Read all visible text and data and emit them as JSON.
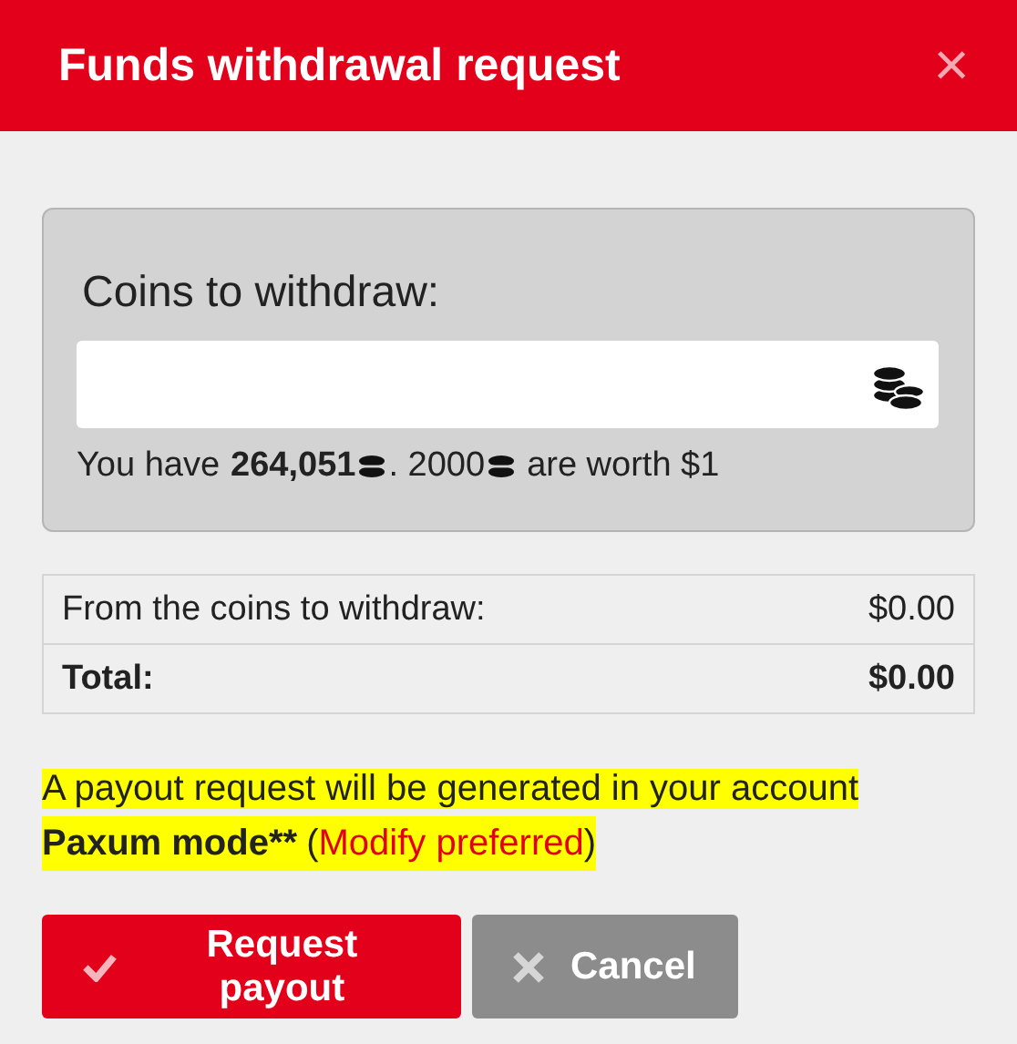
{
  "dialog": {
    "title": "Funds withdrawal request",
    "close": "×"
  },
  "coins": {
    "label": "Coins to withdraw:",
    "balance_prefix": "You have",
    "balance_amount": "264,051",
    "rate_amount": ". 2000",
    "rate_suffix": "are worth $1"
  },
  "summary": [
    {
      "kind": "normal",
      "label": "From the coins to withdraw:",
      "value": "$0.00"
    },
    {
      "kind": "total",
      "label": "Total:",
      "value": "$0.00"
    }
  ],
  "notice": {
    "text": "A payout request will be generated in your account",
    "method": "Paxum mode**",
    "link_before": "(",
    "link": "Modify preferred",
    "link_after": ")"
  },
  "buttons": [
    {
      "kind": "primary",
      "label": "Request payout"
    },
    {
      "kind": "secondary",
      "label": "Cancel"
    }
  ]
}
